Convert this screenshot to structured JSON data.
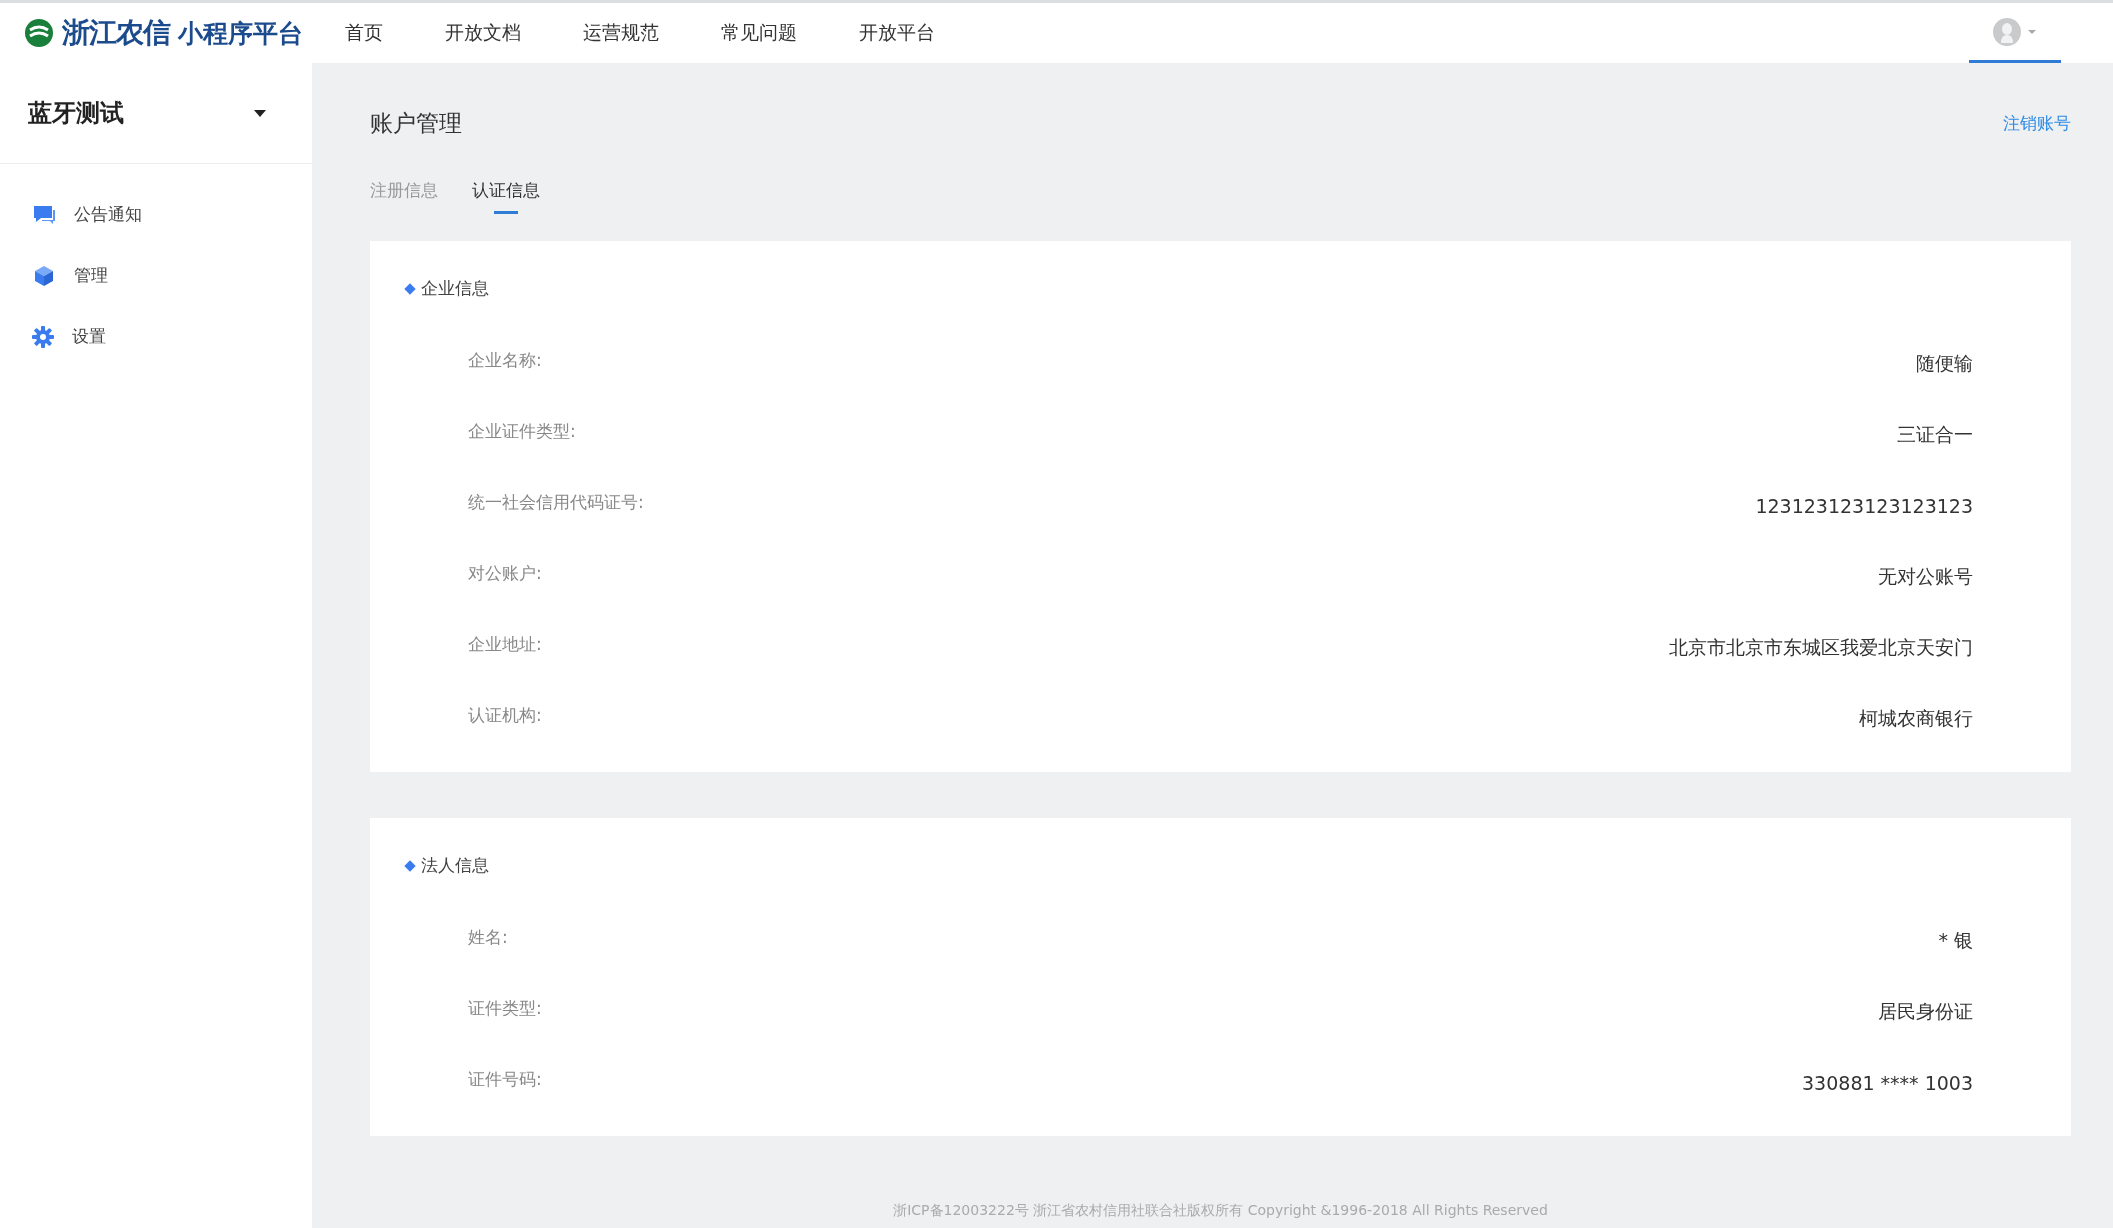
{
  "logo": {
    "brand": "浙江农信",
    "product": "小程序平台"
  },
  "nav": [
    "首页",
    "开放文档",
    "运营规范",
    "常见问题",
    "开放平台"
  ],
  "sidebar": {
    "title": "蓝牙测试",
    "items": [
      {
        "kind": "chat",
        "label": "公告通知"
      },
      {
        "kind": "cube",
        "label": "管理"
      },
      {
        "kind": "gear",
        "label": "设置"
      }
    ]
  },
  "page": {
    "title": "账户管理",
    "action": "注销账号"
  },
  "tabs": [
    {
      "label": "注册信息",
      "selected": false
    },
    {
      "label": "认证信息",
      "selected": true
    }
  ],
  "sections": [
    {
      "title": "企业信息",
      "rows": [
        {
          "label": "企业名称:",
          "value": "随便输"
        },
        {
          "label": "企业证件类型:",
          "value": "三证合一"
        },
        {
          "label": "统一社会信用代码证号:",
          "value": "123123123123123123"
        },
        {
          "label": "对公账户:",
          "value": "无对公账号"
        },
        {
          "label": "企业地址:",
          "value": "北京市北京市东城区我爱北京天安门"
        },
        {
          "label": "认证机构:",
          "value": "柯城农商银行"
        }
      ]
    },
    {
      "title": "法人信息",
      "rows": [
        {
          "label": "姓名:",
          "value": "* 银"
        },
        {
          "label": "证件类型:",
          "value": "居民身份证"
        },
        {
          "label": "证件号码:",
          "value": "330881 **** 1003"
        }
      ]
    }
  ],
  "footer": "浙ICP备12003222号 浙江省农村信用社联合社版权所有 Copyright &1996-2018 All Rights Reserved"
}
